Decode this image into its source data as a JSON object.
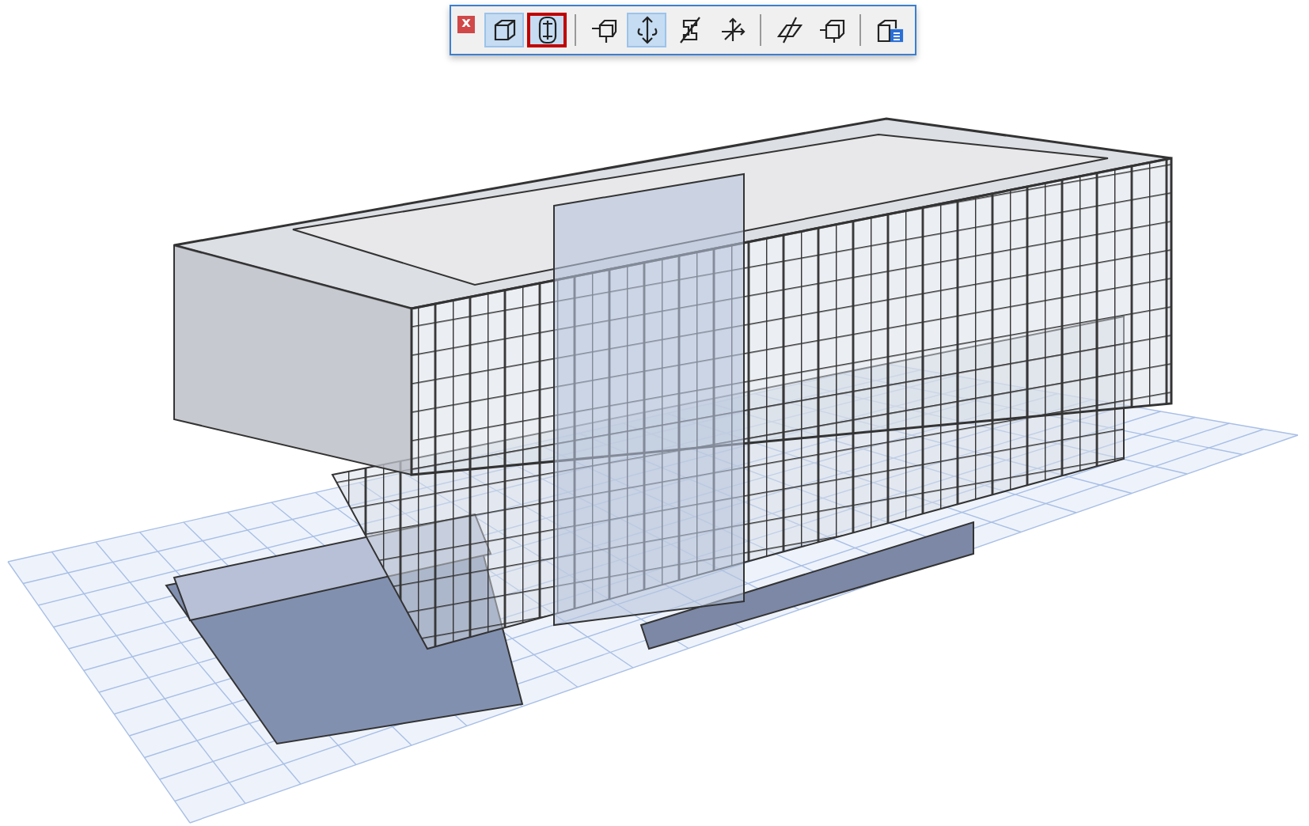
{
  "toolbar": {
    "close": "x",
    "groups": [
      {
        "buttons": [
          {
            "kind": "box",
            "selected": true,
            "emphasized": false
          },
          {
            "kind": "column",
            "selected": true,
            "emphasized": true
          }
        ]
      },
      {
        "buttons": [
          {
            "kind": "corner",
            "selected": false,
            "emphasized": false
          },
          {
            "kind": "rotate",
            "selected": true,
            "emphasized": false
          },
          {
            "kind": "profile",
            "selected": false,
            "emphasized": false
          },
          {
            "kind": "axes",
            "selected": false,
            "emphasized": false
          }
        ]
      },
      {
        "buttons": [
          {
            "kind": "plane",
            "selected": false,
            "emphasized": false
          },
          {
            "kind": "cube",
            "selected": false,
            "emphasized": false
          }
        ]
      },
      {
        "buttons": [
          {
            "kind": "list",
            "selected": false,
            "emphasized": false
          }
        ]
      }
    ]
  }
}
